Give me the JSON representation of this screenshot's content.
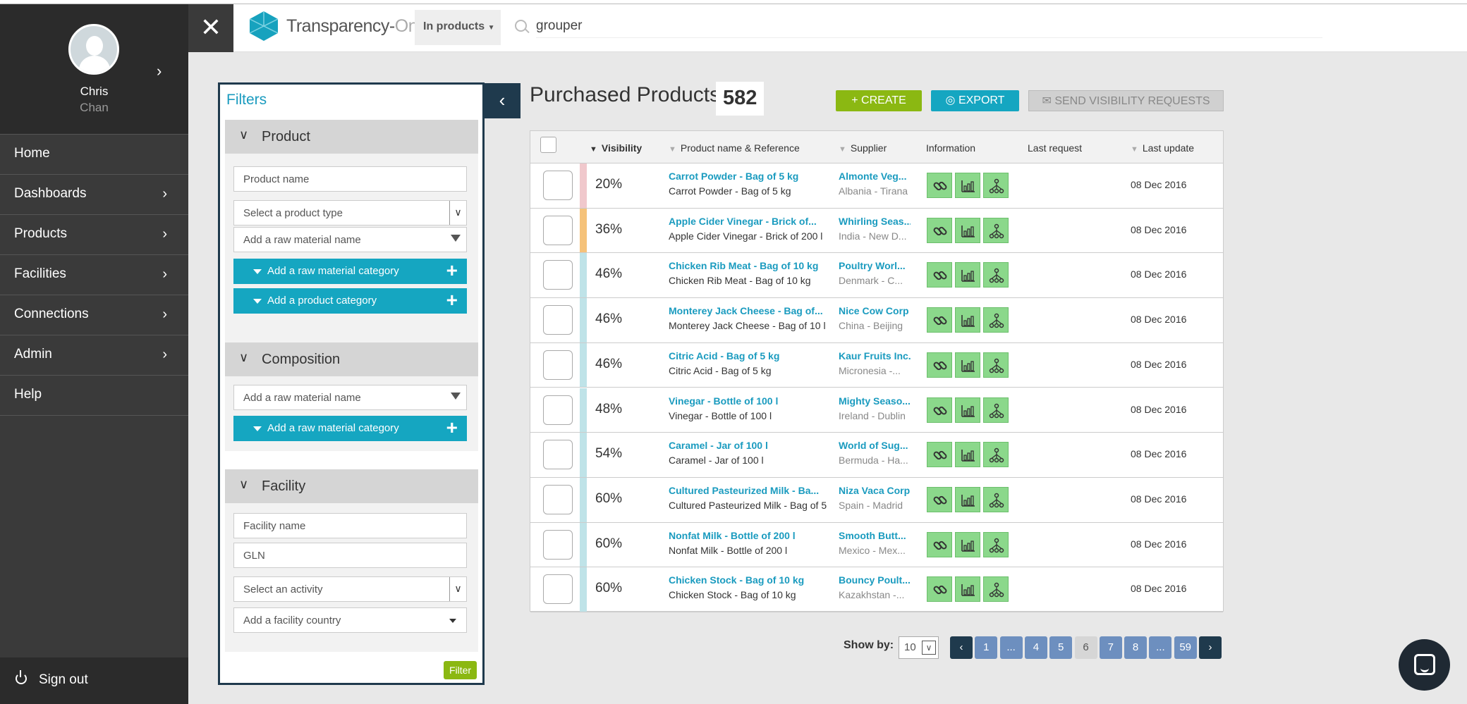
{
  "user": {
    "first_name": "Chris",
    "last_name": "Chan"
  },
  "sidebar": {
    "items": [
      {
        "label": "Home",
        "has_arrow": false
      },
      {
        "label": "Dashboards",
        "has_arrow": true
      },
      {
        "label": "Products",
        "has_arrow": true
      },
      {
        "label": "Facilities",
        "has_arrow": true
      },
      {
        "label": "Connections",
        "has_arrow": true
      },
      {
        "label": "Admin",
        "has_arrow": true
      },
      {
        "label": "Help",
        "has_arrow": false
      }
    ],
    "signout_label": "Sign out"
  },
  "header": {
    "logo_main": "Transparency-",
    "logo_accent": "One",
    "scope_label": "In products",
    "search_value": "grouper"
  },
  "filters": {
    "title": "Filters",
    "product": {
      "heading": "Product",
      "name_placeholder": "Product name",
      "type_select": "Select a product type",
      "raw_material_placeholder": "Add a raw material name",
      "raw_category_btn": "Add a raw material category",
      "product_category_btn": "Add a product category"
    },
    "composition": {
      "heading": "Composition",
      "raw_material_placeholder": "Add a raw material name",
      "raw_category_btn": "Add a raw material category"
    },
    "facility": {
      "heading": "Facility",
      "name_placeholder": "Facility name",
      "gln_placeholder": "GLN",
      "activity_select": "Select an activity",
      "country_select": "Add a facility country"
    },
    "submit_label": "Filter"
  },
  "main": {
    "title": "Purchased Products",
    "count": "582",
    "create_label": "CREATE",
    "export_label": "EXPORT",
    "send_label": "SEND VISIBILITY REQUESTS"
  },
  "table": {
    "headers": {
      "visibility": "Visibility",
      "product": "Product name & Reference",
      "supplier": "Supplier",
      "information": "Information",
      "last_request": "Last request",
      "last_update": "Last update"
    },
    "rows": [
      {
        "visibility": "20%",
        "color": "#f0c8cc",
        "name": "Carrot Powder - Bag of 5 kg",
        "ref": "Carrot Powder - Bag of 5 kg",
        "supplier": "Almonte Veg...",
        "location": "Albania - Tirana",
        "last_request": "",
        "last_update": "08 Dec 2016"
      },
      {
        "visibility": "36%",
        "color": "#f5c27a",
        "name": "Apple Cider Vinegar - Brick of...",
        "ref": "Apple Cider Vinegar - Brick of 200 l",
        "supplier": "Whirling Seas...",
        "location": "India - New D...",
        "last_request": "",
        "last_update": "08 Dec 2016"
      },
      {
        "visibility": "46%",
        "color": "#bfe3e8",
        "name": "Chicken Rib Meat - Bag of 10 kg",
        "ref": "Chicken Rib Meat - Bag of 10 kg",
        "supplier": "Poultry Worl...",
        "location": "Denmark - C...",
        "last_request": "",
        "last_update": "08 Dec 2016"
      },
      {
        "visibility": "46%",
        "color": "#bfe3e8",
        "name": "Monterey Jack Cheese - Bag of...",
        "ref": "Monterey Jack Cheese - Bag of 10 l",
        "supplier": "Nice Cow Corp",
        "location": "China - Beijing",
        "last_request": "",
        "last_update": "08 Dec 2016"
      },
      {
        "visibility": "46%",
        "color": "#bfe3e8",
        "name": "Citric Acid - Bag of 5 kg",
        "ref": "Citric Acid - Bag of 5 kg",
        "supplier": "Kaur Fruits Inc.",
        "location": "Micronesia -...",
        "last_request": "",
        "last_update": "08 Dec 2016"
      },
      {
        "visibility": "48%",
        "color": "#bfe3e8",
        "name": "Vinegar - Bottle of 100 l",
        "ref": "Vinegar - Bottle of 100 l",
        "supplier": "Mighty Seaso...",
        "location": "Ireland - Dublin",
        "last_request": "",
        "last_update": "08 Dec 2016"
      },
      {
        "visibility": "54%",
        "color": "#bfe3e8",
        "name": "Caramel - Jar of 100 l",
        "ref": "Caramel - Jar of 100 l",
        "supplier": "World of Sug...",
        "location": "Bermuda - Ha...",
        "last_request": "",
        "last_update": "08 Dec 2016"
      },
      {
        "visibility": "60%",
        "color": "#bfe3e8",
        "name": "Cultured Pasteurized Milk - Ba...",
        "ref": "Cultured Pasteurized Milk - Bag of 5",
        "supplier": "Niza Vaca Corp",
        "location": "Spain - Madrid",
        "last_request": "",
        "last_update": "08 Dec 2016"
      },
      {
        "visibility": "60%",
        "color": "#bfe3e8",
        "name": "Nonfat Milk - Bottle of 200 l",
        "ref": "Nonfat Milk - Bottle of 200 l",
        "supplier": "Smooth Butt...",
        "location": "Mexico - Mex...",
        "last_request": "",
        "last_update": "08 Dec 2016"
      },
      {
        "visibility": "60%",
        "color": "#bfe3e8",
        "name": "Chicken Stock - Bag of 10 kg",
        "ref": "Chicken Stock - Bag of 10 kg",
        "supplier": "Bouncy Poult...",
        "location": "Kazakhstan -...",
        "last_request": "",
        "last_update": "08 Dec 2016"
      }
    ]
  },
  "pagination": {
    "show_by_label": "Show by:",
    "show_by_value": "10",
    "pages": [
      "1",
      "...",
      "4",
      "5",
      "6",
      "7",
      "8",
      "...",
      "59"
    ],
    "current": "6"
  },
  "colors": {
    "accent_teal": "#15a6c1",
    "accent_green": "#8bb812",
    "dark_navy": "#1f3a4d",
    "sidebar": "#3a3a3a",
    "info_icon_bg": "#8bd88b"
  },
  "icons": {
    "info_buttons": [
      "link-icon",
      "chart-icon",
      "hierarchy-icon"
    ]
  }
}
